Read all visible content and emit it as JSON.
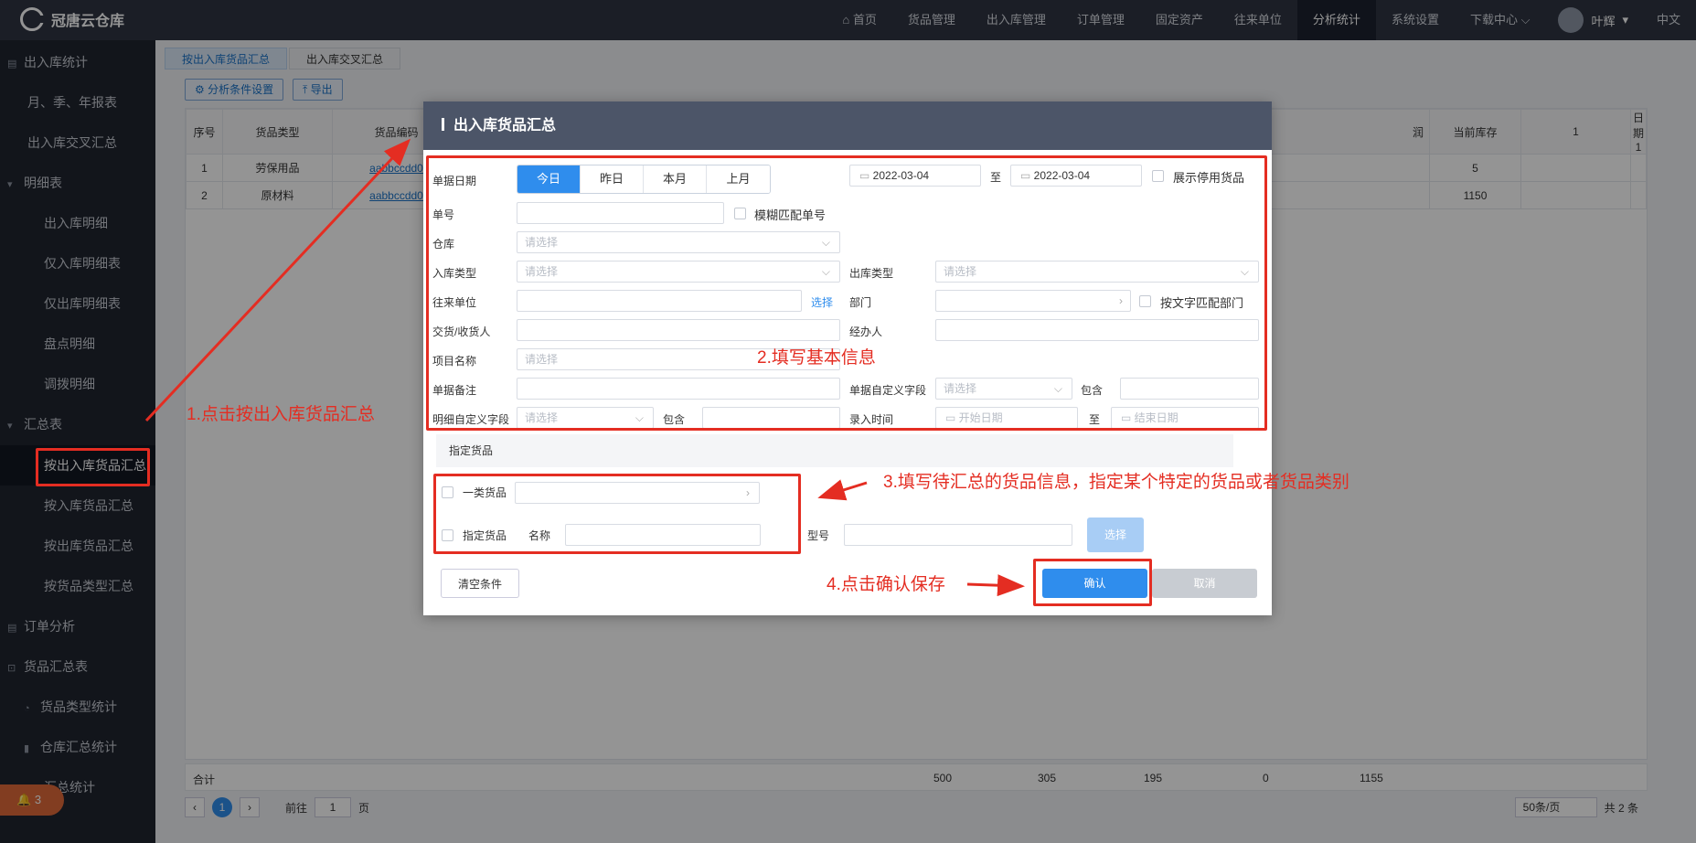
{
  "app": {
    "name": "冠唐云仓库"
  },
  "topnav": {
    "items": [
      "首页",
      "货品管理",
      "出入库管理",
      "订单管理",
      "固定资产",
      "往来单位",
      "分析统计",
      "系统设置",
      "下载中心"
    ],
    "user": "叶辉",
    "lang": "中文"
  },
  "sidebar": {
    "items": [
      "出入库统计",
      "月、季、年报表",
      "出入库交叉汇总",
      "明细表",
      "出入库明细",
      "仅入库明细表",
      "仅出库明细表",
      "盘点明细",
      "调拨明细",
      "汇总表",
      "按出入库货品汇总",
      "按入库货品汇总",
      "按出库货品汇总",
      "按货品类型汇总",
      "订单分析",
      "货品汇总表",
      "货品类型统计",
      "仓库汇总统计",
      "汇总统计"
    ],
    "badge": "3"
  },
  "tabs": [
    "按出入库货品汇总",
    "出入库交叉汇总"
  ],
  "toolbar": {
    "settings": "分析条件设置",
    "export": "导出"
  },
  "grid": {
    "headers": [
      "序号",
      "货品类型",
      "货品编码",
      "润",
      "当前库存",
      "1",
      "日期1"
    ],
    "rows": [
      [
        "1",
        "劳保用品",
        "aabbccdd0",
        "",
        "5",
        "",
        ""
      ],
      [
        "2",
        "原材料",
        "aabbccdd0",
        "",
        "1150",
        "",
        ""
      ]
    ],
    "totals_label": "合计",
    "totals": [
      "500",
      "305",
      "195",
      "0",
      "1155"
    ]
  },
  "pager": {
    "current": "1",
    "goto_label": "前往",
    "goto_value": "1",
    "page_unit": "页",
    "page_size": "50条/页",
    "total": "共 2 条"
  },
  "modal": {
    "title": "出入库货品汇总",
    "labels": {
      "date": "单据日期",
      "number": "单号",
      "fuzzy": "模糊匹配单号",
      "warehouse": "仓库",
      "in_type": "入库类型",
      "out_type": "出库类型",
      "partner": "往来单位",
      "choose": "选择",
      "dept": "部门",
      "dept_match": "按文字匹配部门",
      "receiver": "交货/收货人",
      "handler": "经办人",
      "project": "项目名称",
      "remark": "单据备注",
      "doc_field": "单据自定义字段",
      "contains": "包含",
      "detail_field": "明细自定义字段",
      "entry_time": "录入时间",
      "to": "至",
      "show_disabled": "展示停用货品",
      "goods_section": "指定货品",
      "cat_goods": "一类货品",
      "spec_goods": "指定货品",
      "name": "名称",
      "model": "型号"
    },
    "date_tabs": [
      "今日",
      "昨日",
      "本月",
      "上月"
    ],
    "date_from": "2022-03-04",
    "date_to": "2022-03-04",
    "placeholder": "请选择",
    "start_date": "开始日期",
    "end_date": "结束日期",
    "buttons": {
      "clear": "清空条件",
      "select": "选择",
      "confirm": "确认",
      "cancel": "取消"
    }
  },
  "annotations": {
    "a1": "1.点击按出入库货品汇总",
    "a2": "2.填写基本信息",
    "a3": "3.填写待汇总的货品信息，指定某个特定的货品或者货品类别",
    "a4": "4.点击确认保存"
  },
  "colors": {
    "accent": "#2f8ded",
    "annotation": "#e42d22",
    "topbar": "#2f3543",
    "sidebar": "#1f2530"
  }
}
